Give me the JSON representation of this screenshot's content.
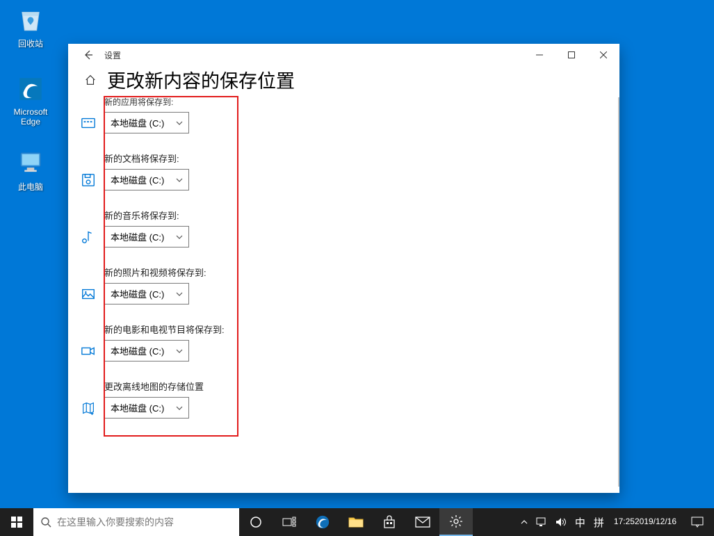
{
  "desktop": {
    "recycle_bin": "回收站",
    "edge": "Microsoft Edge",
    "this_pc": "此电脑"
  },
  "window": {
    "title": "设置",
    "heading": "更改新内容的保存位置",
    "disk_option": "本地磁盘 (C:)",
    "cut_label": "新的应用将保存到:",
    "sections": [
      {
        "label": "新的文档将保存到:"
      },
      {
        "label": "新的音乐将保存到:"
      },
      {
        "label": "新的照片和视频将保存到:"
      },
      {
        "label": "新的电影和电视节目将保存到:"
      },
      {
        "label": "更改离线地图的存储位置"
      }
    ]
  },
  "taskbar": {
    "search_placeholder": "在这里输入你要搜索的内容",
    "ime1": "中",
    "ime2": "拼",
    "time": "17:25",
    "date": "2019/12/16"
  }
}
